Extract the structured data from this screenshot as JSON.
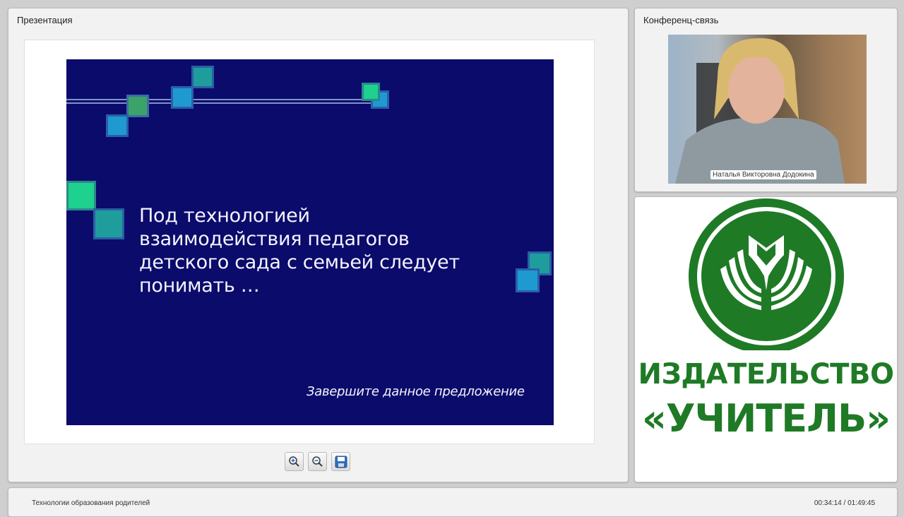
{
  "presentation": {
    "title": "Презентация",
    "slide": {
      "text": "Под технологией взаимодействия педагогов детского сада с семьей следует понимать …",
      "note": "Завершите данное предложение"
    },
    "toolbar": [
      {
        "icon": "zoom-in-icon"
      },
      {
        "icon": "zoom-out-icon"
      },
      {
        "icon": "save-icon"
      }
    ]
  },
  "conference": {
    "title": "Конференц-связь",
    "participant_name": "Наталья Викторовна Додокина"
  },
  "logo": {
    "line1": "ИЗДАТЕЛЬСТВО",
    "line2": "«УЧИТЕЛЬ»",
    "color": "#1f7a26"
  },
  "footer": {
    "course_title": "Технологии образования родителей",
    "time": "00:34:14 / 01:49:45"
  }
}
